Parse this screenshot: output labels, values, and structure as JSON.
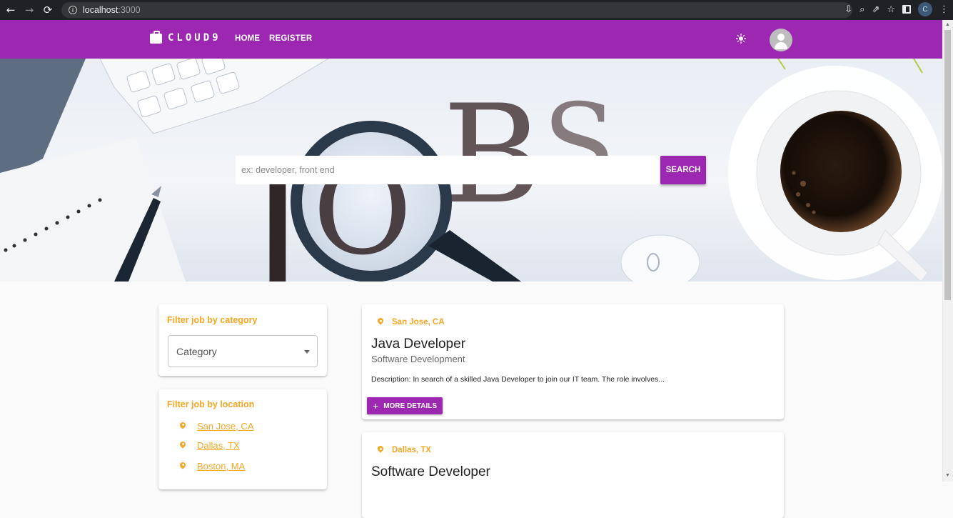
{
  "browser": {
    "url_host": "localhost",
    "url_port": ":3000",
    "profile_initial": "C"
  },
  "appbar": {
    "brand": "CLOUD9",
    "nav": [
      "HOME",
      "REGISTER"
    ],
    "color": "#9c27b0"
  },
  "hero": {
    "search_placeholder": "ex: developer, front end",
    "search_button": "SEARCH"
  },
  "filters": {
    "category_title": "Filter job by category",
    "category_select": "Category",
    "location_title": "Filter job by location",
    "locations": [
      "San Jose, CA",
      "Dallas, TX",
      "Boston, MA"
    ],
    "accent": "#f5a623"
  },
  "jobs": [
    {
      "location": "San Jose, CA",
      "title": "Java Developer",
      "category": "Software Development",
      "description": "Description: In search of a skilled Java Developer to join our IT team. The role involves...",
      "button": "MORE DETAILS"
    },
    {
      "location": "Dallas, TX",
      "title": "Software Developer"
    }
  ]
}
